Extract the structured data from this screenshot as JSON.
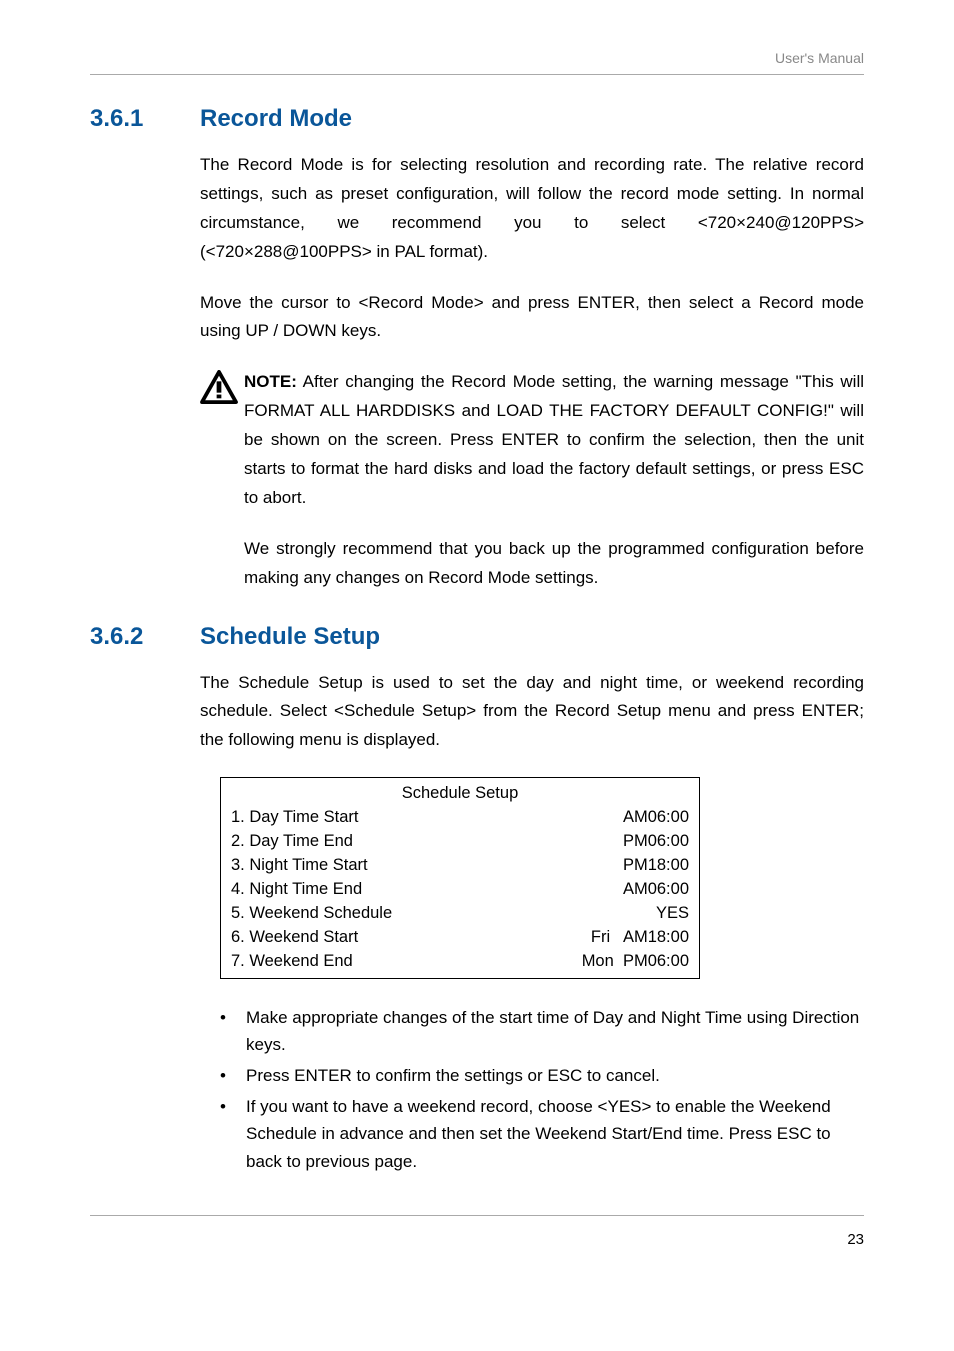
{
  "header": {
    "label": "User's Manual"
  },
  "sections": [
    {
      "num": "3.6.1",
      "title": "Record Mode",
      "paras": [
        "The Record Mode is for selecting resolution and recording rate. The relative record settings, such as preset configuration, will follow the record mode setting. In normal circumstance, we recommend you to select <720×240@120PPS> (<720×288@100PPS> in PAL format).",
        "Move the cursor to <Record Mode> and press ENTER, then select a Record mode using UP / DOWN keys."
      ],
      "note_label": "NOTE:",
      "note_text": " After changing the Record Mode setting, the warning message \"This will FORMAT ALL HARDDISKS and LOAD THE FACTORY DEFAULT CONFIG!\" will be shown on the screen. Press ENTER to confirm the selection, then the unit starts to format the hard disks and load the factory default settings, or press ESC to abort.",
      "note_follow": "We strongly recommend that you back up the programmed configuration before making any changes on Record Mode settings."
    },
    {
      "num": "3.6.2",
      "title": "Schedule Setup",
      "paras": [
        "The Schedule Setup is used to set the day and night time, or weekend recording schedule. Select <Schedule Setup> from the Record Setup menu and press ENTER; the following menu is displayed."
      ]
    }
  ],
  "schedule": {
    "title": "Schedule Setup",
    "rows": [
      {
        "label": "1. Day Time Start",
        "value": "AM06:00"
      },
      {
        "label": "2. Day Time End",
        "value": "PM06:00"
      },
      {
        "label": "3. Night Time Start",
        "value": "PM18:00"
      },
      {
        "label": "4. Night Time End",
        "value": "AM06:00"
      },
      {
        "label": "5. Weekend Schedule",
        "value": "YES"
      },
      {
        "label": "6. Weekend Start",
        "value": "Fri   AM18:00"
      },
      {
        "label": "7. Weekend End",
        "value": "Mon  PM06:00"
      }
    ]
  },
  "bullets": [
    "Make appropriate changes of the start time of Day and Night Time using Direction keys.",
    "Press ENTER to confirm the settings or ESC to cancel.",
    "If you want to have a weekend record, choose <YES> to enable the Weekend Schedule in advance and then set the Weekend Start/End time. Press ESC to back to previous page."
  ],
  "page_number": "23"
}
